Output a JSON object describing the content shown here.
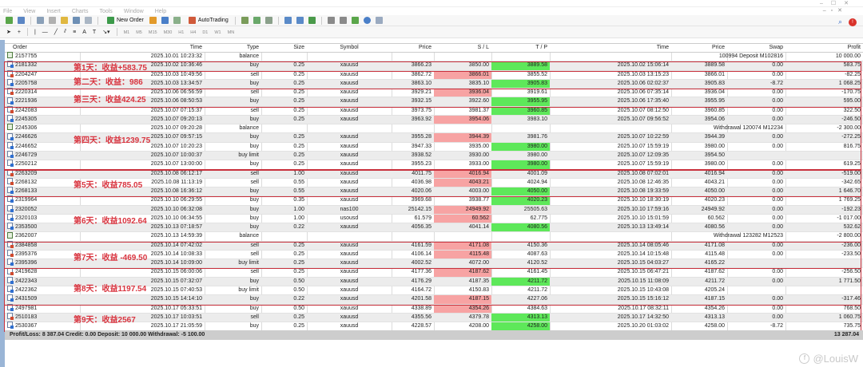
{
  "menu": [
    "File",
    "View",
    "Insert",
    "Charts",
    "Tools",
    "Window",
    "Help"
  ],
  "toolbar": {
    "new_order": "New Order",
    "auto_trading": "AutoTrading",
    "timeframes": [
      "M1",
      "M5",
      "M15",
      "M30",
      "H1",
      "H4",
      "D1",
      "W1",
      "MN"
    ]
  },
  "columns": {
    "order": "Order",
    "time": "Time",
    "type": "Type",
    "size": "Size",
    "symbol": "Symbol",
    "price": "Price",
    "sl": "S / L",
    "tp": "T / P",
    "ctime": "Time",
    "cprice": "Price",
    "swap": "Swap",
    "profit": "Profit"
  },
  "rows": [
    {
      "order": "2157755",
      "time": "2025.10.01 10:23:32",
      "type": "balance",
      "comment": "100994 Deposit M102816",
      "profit": "10 000.00"
    },
    {
      "order": "2181332",
      "time": "2025.10.02 10:36:46",
      "type": "buy",
      "size": "0.25",
      "symbol": "xauusd",
      "price": "3866.23",
      "sl": "3850.00",
      "tp": "3889.58",
      "ctime": "2025.10.02 15:06:14",
      "cprice": "3889.58",
      "swap": "0.00",
      "profit": "583.75",
      "hit": "tp"
    },
    {
      "order": "2204247",
      "time": "2025.10.03 10:49:56",
      "type": "sell",
      "size": "0.25",
      "symbol": "xauusd",
      "price": "3862.72",
      "sl": "3866.01",
      "tp": "3855.52",
      "ctime": "2025.10.03 13:15:23",
      "cprice": "3866.01",
      "swap": "0.00",
      "profit": "-82.25",
      "hit": "sl"
    },
    {
      "order": "2205758",
      "time": "2025.10.03 13:34:57",
      "type": "buy",
      "size": "0.25",
      "symbol": "xauusd",
      "price": "3863.10",
      "sl": "3835.10",
      "tp": "3905.83",
      "ctime": "2025.10.06 02:02:37",
      "cprice": "3905.83",
      "swap": "-8.72",
      "profit": "1 068.25",
      "hit": "tp"
    },
    {
      "order": "2220314",
      "time": "2025.10.06 06:56:59",
      "type": "sell",
      "size": "0.25",
      "symbol": "xauusd",
      "price": "3929.21",
      "sl": "3936.04",
      "tp": "3919.61",
      "ctime": "2025.10.06 07:35:14",
      "cprice": "3936.04",
      "swap": "0.00",
      "profit": "-170.75",
      "hit": "sl"
    },
    {
      "order": "2221936",
      "time": "2025.10.06 08:50:53",
      "type": "buy",
      "size": "0.25",
      "symbol": "xauusd",
      "price": "3932.15",
      "sl": "3922.60",
      "tp": "3955.95",
      "ctime": "2025.10.06 17:35:40",
      "cprice": "3955.95",
      "swap": "0.00",
      "profit": "595.00",
      "hit": "tp"
    },
    {
      "order": "2242083",
      "time": "2025.10.07 07:15:37",
      "type": "sell",
      "size": "0.25",
      "symbol": "xauusd",
      "price": "3973.75",
      "sl": "3981.37",
      "tp": "3960.85",
      "ctime": "2025.10.07 08:12:50",
      "cprice": "3960.85",
      "swap": "0.00",
      "profit": "322.50",
      "hit": "tp"
    },
    {
      "order": "2245305",
      "time": "2025.10.07 09:20:13",
      "type": "buy",
      "size": "0.25",
      "symbol": "xauusd",
      "price": "3963.92",
      "sl": "3954.06",
      "tp": "3983.10",
      "ctime": "2025.10.07 09:56:52",
      "cprice": "3954.06",
      "swap": "0.00",
      "profit": "-246.50",
      "hit": "sl"
    },
    {
      "order": "2245306",
      "time": "2025.10.07 09:20:28",
      "type": "balance",
      "comment": "Withdrawal 120074 M12234",
      "profit": "-2 300.00"
    },
    {
      "order": "2246626",
      "time": "2025.10.07 09:57:15",
      "type": "buy",
      "size": "0.25",
      "symbol": "xauusd",
      "price": "3955.28",
      "sl": "3944.39",
      "tp": "3981.76",
      "ctime": "2025.10.07 10:22:59",
      "cprice": "3944.39",
      "swap": "0.00",
      "profit": "-272.25",
      "hit": "sl"
    },
    {
      "order": "2246652",
      "time": "2025.10.07 10:20:23",
      "type": "buy",
      "size": "0.25",
      "symbol": "xauusd",
      "price": "3947.33",
      "sl": "3935.00",
      "tp": "3980.00",
      "ctime": "2025.10.07 15:59:19",
      "cprice": "3980.00",
      "swap": "0.00",
      "profit": "816.75",
      "hit": "tp"
    },
    {
      "order": "2246729",
      "time": "2025.10.07 10:00:37",
      "type": "buy limit",
      "size": "0.25",
      "symbol": "xauusd",
      "price": "3938.52",
      "sl": "3930.00",
      "tp": "3980.00",
      "ctime": "2025.10.07 12:09:35",
      "cprice": "3954.50"
    },
    {
      "order": "2250212",
      "time": "2025.10.07 13:00:00",
      "type": "buy",
      "size": "0.25",
      "symbol": "xauusd",
      "price": "3955.23",
      "sl": "3933.00",
      "tp": "3980.00",
      "ctime": "2025.10.07 15:59:19",
      "cprice": "3980.00",
      "swap": "0.00",
      "profit": "619.25",
      "hit": "tp"
    },
    {
      "order": "2263209",
      "time": "2025.10.08 06:12:17",
      "type": "sell",
      "size": "1.00",
      "symbol": "xauusd",
      "price": "4011.75",
      "sl": "4016.94",
      "tp": "4001.09",
      "ctime": "2025.10.08 07:02:01",
      "cprice": "4016.94",
      "swap": "0.00",
      "profit": "-519.00",
      "hit": "sl"
    },
    {
      "order": "2268132",
      "time": "2025.10.08 11:13:19",
      "type": "sell",
      "size": "0.55",
      "symbol": "xauusd",
      "price": "4036.98",
      "sl": "4043.21",
      "tp": "4024.94",
      "ctime": "2025.10.08 12:46:35",
      "cprice": "4043.21",
      "swap": "0.00",
      "profit": "-342.65",
      "hit": "sl"
    },
    {
      "order": "2268133",
      "time": "2025.10.08 16:36:12",
      "type": "buy",
      "size": "0.55",
      "symbol": "xauusd",
      "price": "4020.06",
      "sl": "4003.00",
      "tp": "4050.00",
      "ctime": "2025.10.08 19:33:59",
      "cprice": "4050.00",
      "swap": "0.00",
      "profit": "1 646.70",
      "hit": "tp"
    },
    {
      "order": "2319964",
      "time": "2025.10.10 06:29:55",
      "type": "buy",
      "size": "0.35",
      "symbol": "xauusd",
      "price": "3969.68",
      "sl": "3938.77",
      "tp": "4020.23",
      "ctime": "2025.10.10 18:30:19",
      "cprice": "4020.23",
      "swap": "0.00",
      "profit": "1 769.25",
      "hit": "tp"
    },
    {
      "order": "2320052",
      "time": "2025.10.10 06:32:08",
      "type": "buy",
      "size": "1.00",
      "symbol": "nas100",
      "price": "25142.15",
      "sl": "24949.92",
      "tp": "25505.63",
      "ctime": "2025.10.10 17:59:16",
      "cprice": "24949.92",
      "swap": "0.00",
      "profit": "-192.23",
      "hit": "sl"
    },
    {
      "order": "2320103",
      "time": "2025.10.10 06:34:55",
      "type": "buy",
      "size": "1.00",
      "symbol": "usousd",
      "price": "61.579",
      "sl": "60.562",
      "tp": "62.775",
      "ctime": "2025.10.10 15:01:59",
      "cprice": "60.562",
      "swap": "0.00",
      "profit": "-1 017.00",
      "hit": "sl"
    },
    {
      "order": "2353500",
      "time": "2025.10.13 07:18:57",
      "type": "buy",
      "size": "0.22",
      "symbol": "xauusd",
      "price": "4056.35",
      "sl": "4041.14",
      "tp": "4080.56",
      "ctime": "2025.10.13 13:49:14",
      "cprice": "4080.56",
      "swap": "0.00",
      "profit": "532.62",
      "hit": "tp"
    },
    {
      "order": "2362007",
      "time": "2025.10.13 14:59:39",
      "type": "balance",
      "comment": "Withdrawal 123282 M12523",
      "profit": "-2 800.00"
    },
    {
      "order": "2384858",
      "time": "2025.10.14 07:42:02",
      "type": "sell",
      "size": "0.25",
      "symbol": "xauusd",
      "price": "4161.59",
      "sl": "4171.08",
      "tp": "4150.36",
      "ctime": "2025.10.14 08:05:46",
      "cprice": "4171.08",
      "swap": "0.00",
      "profit": "-236.00",
      "hit": "sl"
    },
    {
      "order": "2395376",
      "time": "2025.10.14 10:08:33",
      "type": "sell",
      "size": "0.25",
      "symbol": "xauusd",
      "price": "4106.14",
      "sl": "4115.48",
      "tp": "4087.63",
      "ctime": "2025.10.14 10:15:48",
      "cprice": "4115.48",
      "swap": "0.00",
      "profit": "-233.50",
      "hit": "sl"
    },
    {
      "order": "2395396",
      "time": "2025.10.14 10:09:00",
      "type": "buy limit",
      "size": "0.25",
      "symbol": "xauusd",
      "price": "4002.52",
      "sl": "4072.00",
      "tp": "4120.52",
      "ctime": "2025.10.15 04:03:27",
      "cprice": "4165.22"
    },
    {
      "order": "2419628",
      "time": "2025.10.15 06:00:06",
      "type": "sell",
      "size": "0.25",
      "symbol": "xauusd",
      "price": "4177.36",
      "sl": "4187.62",
      "tp": "4161.45",
      "ctime": "2025.10.15 06:47:21",
      "cprice": "4187.62",
      "swap": "0.00",
      "profit": "-256.50",
      "hit": "sl"
    },
    {
      "order": "2422343",
      "time": "2025.10.15 07:32:07",
      "type": "buy",
      "size": "0.50",
      "symbol": "xauusd",
      "price": "4176.29",
      "sl": "4187.35",
      "tp": "4211.72",
      "ctime": "2025.10.15 11:08:09",
      "cprice": "4211.72",
      "swap": "0.00",
      "profit": "1 771.50",
      "hit": "tp"
    },
    {
      "order": "2422362",
      "time": "2025.10.15 07:40:53",
      "type": "buy limit",
      "size": "0.50",
      "symbol": "xauusd",
      "price": "4164.72",
      "sl": "4150.83",
      "tp": "4211.72",
      "ctime": "2025.10.15 10:43:08",
      "cprice": "4205.24"
    },
    {
      "order": "2431509",
      "time": "2025.10.15 14:14:10",
      "type": "buy",
      "size": "0.22",
      "symbol": "xauusd",
      "price": "4201.58",
      "sl": "4187.15",
      "tp": "4227.06",
      "ctime": "2025.10.15 15:16:12",
      "cprice": "4187.15",
      "swap": "0.00",
      "profit": "-317.46",
      "hit": "sl"
    },
    {
      "order": "2497981",
      "time": "2025.10.17 05:33:51",
      "type": "buy",
      "size": "0.50",
      "symbol": "xauusd",
      "price": "4338.89",
      "sl": "4354.26",
      "tp": "4384.63",
      "ctime": "2025.10.17 08:32:11",
      "cprice": "4354.26",
      "swap": "0.00",
      "profit": "768.50",
      "hit": "sl"
    },
    {
      "order": "2510183",
      "time": "2025.10.17 10:03:51",
      "type": "sell",
      "size": "0.25",
      "symbol": "xauusd",
      "price": "4355.56",
      "sl": "4379.78",
      "tp": "4313.13",
      "ctime": "2025.10.17 14:32:50",
      "cprice": "4313.13",
      "swap": "0.00",
      "profit": "1 060.75",
      "hit": "tp"
    },
    {
      "order": "2530367",
      "time": "2025.10.17 21:05:59",
      "type": "buy",
      "size": "0.25",
      "symbol": "xauusd",
      "price": "4228.57",
      "sl": "4208.00",
      "tp": "4258.00",
      "ctime": "2025.10.20 01:03:02",
      "cprice": "4258.00",
      "swap": "-8.72",
      "profit": "735.75",
      "hit": "tp"
    }
  ],
  "annotations": [
    {
      "label": "第1天：收益+583.75",
      "first_row": 1,
      "row_count": 1
    },
    {
      "label": "第二天：收益：986",
      "first_row": 2,
      "row_count": 2
    },
    {
      "label": "第三天：收益424.25",
      "first_row": 4,
      "row_count": 2
    },
    {
      "label": "第四天：收益1239.75",
      "first_row": 6,
      "row_count": 7
    },
    {
      "label": "第5天：收益785.05",
      "first_row": 13,
      "row_count": 3
    },
    {
      "label": "第6天：收益1092.64",
      "first_row": 16,
      "row_count": 5
    },
    {
      "label": "第7天：收益 -469.50",
      "first_row": 21,
      "row_count": 3
    },
    {
      "label": "第8天：收益1197.54",
      "first_row": 24,
      "row_count": 4
    },
    {
      "label": "第9天：收益2567",
      "first_row": 28,
      "row_count": 3
    }
  ],
  "footer": {
    "summary": "Profit/Loss: 8 387.04  Credit: 0.00  Deposit: 10 000.00  Withdrawal: -5 100.00",
    "total": "13 287.04"
  },
  "watermark": "@LouisW",
  "colors": {
    "sl_hit": "#f7a3a3",
    "tp_hit": "#5ee85a",
    "annotation": "#d9343f"
  }
}
